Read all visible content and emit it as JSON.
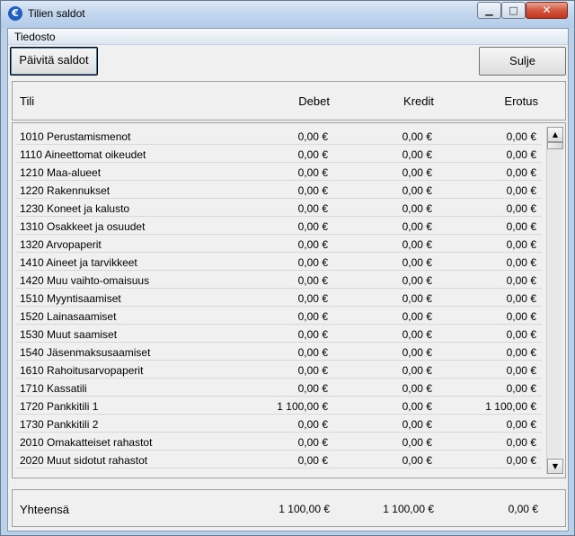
{
  "window": {
    "title": "Tilien saldot",
    "icon": "euro-icon"
  },
  "menu": {
    "file": "Tiedosto"
  },
  "toolbar": {
    "refresh_label": "Päivitä saldot",
    "close_label": "Sulje"
  },
  "columns": {
    "account": "Tili",
    "debit": "Debet",
    "credit": "Kredit",
    "difference": "Erotus"
  },
  "rows": [
    {
      "account": "1010 Perustamismenot",
      "debit": "0,00 €",
      "credit": "0,00 €",
      "difference": "0,00 €"
    },
    {
      "account": "1110 Aineettomat oikeudet",
      "debit": "0,00 €",
      "credit": "0,00 €",
      "difference": "0,00 €"
    },
    {
      "account": "1210 Maa-alueet",
      "debit": "0,00 €",
      "credit": "0,00 €",
      "difference": "0,00 €"
    },
    {
      "account": "1220 Rakennukset",
      "debit": "0,00 €",
      "credit": "0,00 €",
      "difference": "0,00 €"
    },
    {
      "account": "1230 Koneet ja kalusto",
      "debit": "0,00 €",
      "credit": "0,00 €",
      "difference": "0,00 €"
    },
    {
      "account": "1310 Osakkeet ja osuudet",
      "debit": "0,00 €",
      "credit": "0,00 €",
      "difference": "0,00 €"
    },
    {
      "account": "1320 Arvopaperit",
      "debit": "0,00 €",
      "credit": "0,00 €",
      "difference": "0,00 €"
    },
    {
      "account": "1410 Aineet ja tarvikkeet",
      "debit": "0,00 €",
      "credit": "0,00 €",
      "difference": "0,00 €"
    },
    {
      "account": "1420 Muu vaihto-omaisuus",
      "debit": "0,00 €",
      "credit": "0,00 €",
      "difference": "0,00 €"
    },
    {
      "account": "1510 Myyntisaamiset",
      "debit": "0,00 €",
      "credit": "0,00 €",
      "difference": "0,00 €"
    },
    {
      "account": "1520 Lainasaamiset",
      "debit": "0,00 €",
      "credit": "0,00 €",
      "difference": "0,00 €"
    },
    {
      "account": "1530 Muut saamiset",
      "debit": "0,00 €",
      "credit": "0,00 €",
      "difference": "0,00 €"
    },
    {
      "account": "1540 Jäsenmaksusaamiset",
      "debit": "0,00 €",
      "credit": "0,00 €",
      "difference": "0,00 €"
    },
    {
      "account": "1610 Rahoitusarvopaperit",
      "debit": "0,00 €",
      "credit": "0,00 €",
      "difference": "0,00 €"
    },
    {
      "account": "1710 Kassatili",
      "debit": "0,00 €",
      "credit": "0,00 €",
      "difference": "0,00 €"
    },
    {
      "account": "1720 Pankkitili 1",
      "debit": "1 100,00 €",
      "credit": "0,00 €",
      "difference": "1 100,00 €"
    },
    {
      "account": "1730 Pankkitili 2",
      "debit": "0,00 €",
      "credit": "0,00 €",
      "difference": "0,00 €"
    },
    {
      "account": "2010 Omakatteiset rahastot",
      "debit": "0,00 €",
      "credit": "0,00 €",
      "difference": "0,00 €"
    },
    {
      "account": "2020 Muut sidotut rahastot",
      "debit": "0,00 €",
      "credit": "0,00 €",
      "difference": "0,00 €"
    }
  ],
  "totals": {
    "label": "Yhteensä",
    "debit": "1 100,00 €",
    "credit": "1 100,00 €",
    "difference": "0,00 €"
  }
}
